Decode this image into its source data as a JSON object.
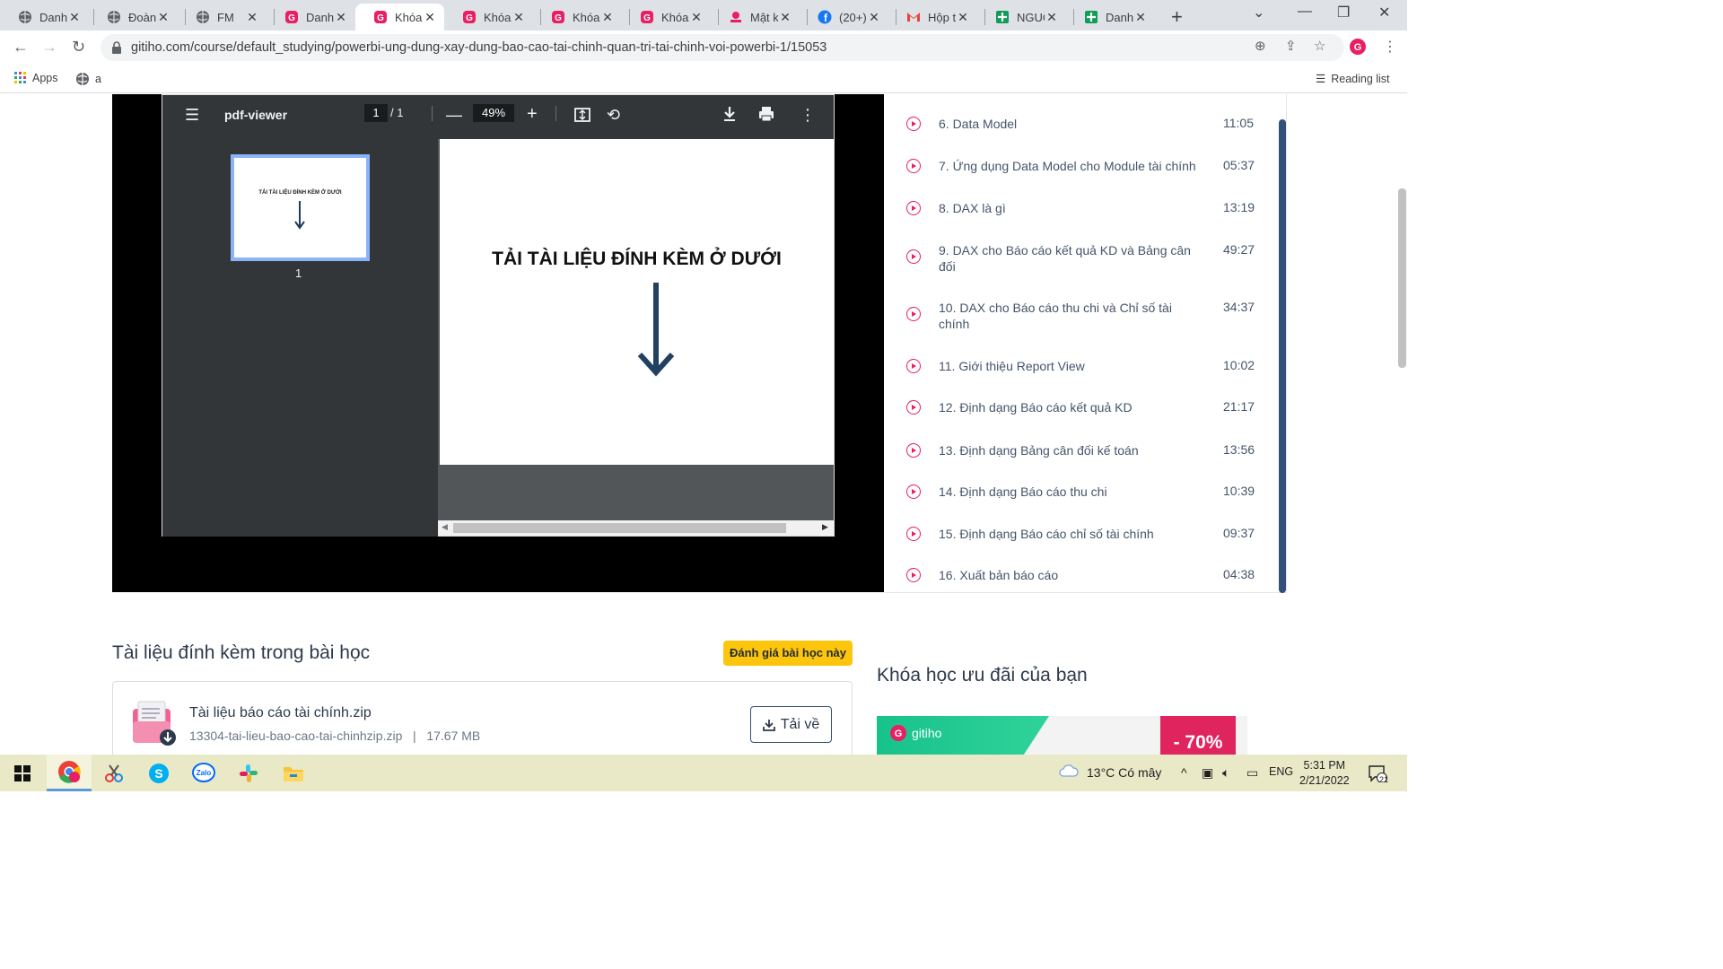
{
  "browser": {
    "tabs": [
      {
        "title": "Danh",
        "icon": "globe-icon"
      },
      {
        "title": "Đoàn",
        "icon": "globe-icon"
      },
      {
        "title": "FM",
        "icon": "globe-icon"
      },
      {
        "title": "Danh",
        "icon": "gitiho-icon"
      },
      {
        "title": "Khóa",
        "icon": "gitiho-icon",
        "active": true
      },
      {
        "title": "Khóa",
        "icon": "gitiho-icon"
      },
      {
        "title": "Khóa",
        "icon": "gitiho-icon"
      },
      {
        "title": "Khóa",
        "icon": "gitiho-icon"
      },
      {
        "title": "Mật k",
        "icon": "gitiho-small-icon"
      },
      {
        "title": "(20+)",
        "icon": "facebook-icon"
      },
      {
        "title": "Hộp t",
        "icon": "gmail-icon"
      },
      {
        "title": "NGUỒ",
        "icon": "sheets-icon"
      },
      {
        "title": "Danh",
        "icon": "sheets-icon"
      }
    ],
    "url": "gitiho.com/course/default_studying/powerbi-ung-dung-xay-dung-bao-cao-tai-chinh-quan-tri-tai-chinh-voi-powerbi-1/15053",
    "bookmarks": {
      "apps": "Apps",
      "item1": "a",
      "reading_list": "Reading list"
    }
  },
  "pdf_viewer": {
    "title": "pdf-viewer",
    "page_current": "1",
    "page_total": "/ 1",
    "zoom": "49%",
    "thumbnail_label": "1",
    "thumbnail_text": "TẢI TÀI LIỆU ĐÍNH KÈM Ở DƯỚI",
    "page_heading": "TẢI TÀI LIỆU ĐÍNH KÈM Ở DƯỚI"
  },
  "lessons": [
    {
      "title": "6. Data Model",
      "duration": "11:05"
    },
    {
      "title": "7. Ứng dụng Data Model cho Module tài chính",
      "duration": "05:37"
    },
    {
      "title": "8. DAX là gì",
      "duration": "13:19"
    },
    {
      "title": "9. DAX cho Báo cáo kết quả KD và Bảng cân đối",
      "duration": "49:27"
    },
    {
      "title": "10. DAX cho Báo cáo thu chi và Chỉ số tài chính",
      "duration": "34:37"
    },
    {
      "title": "11. Giới thiệu Report View",
      "duration": "10:02"
    },
    {
      "title": "12. Định dạng Báo cáo kết quả KD",
      "duration": "21:17"
    },
    {
      "title": "13. Định dạng Bảng cân đối kế toán",
      "duration": "13:56"
    },
    {
      "title": "14. Định dạng Báo cáo thu chi",
      "duration": "10:39"
    },
    {
      "title": "15. Định dạng Báo cáo chỉ số tài chính",
      "duration": "09:37"
    },
    {
      "title": "16. Xuất bản báo cáo",
      "duration": "04:38"
    }
  ],
  "attachments": {
    "section_title": "Tài liệu đính kèm trong bài học",
    "rate_button": "Đánh giá bài học này",
    "file_name": "Tài liệu báo cáo tài chính.zip",
    "file_meta": "13304-tai-lieu-bao-cao-tai-chinhzip.zip   |   17.67 MB",
    "download_button": "Tải về"
  },
  "offers": {
    "title": "Khóa học ưu đãi của bạn",
    "brand": "gitiho",
    "discount": "- 70%"
  },
  "taskbar": {
    "weather": "13°C  Có mây",
    "lang": "ENG",
    "time": "5:31 PM",
    "date": "2/21/2022",
    "notifications": "21"
  },
  "colors": {
    "accent": "#e91e63",
    "navy": "#33507a",
    "yellow": "#fdc50c"
  }
}
